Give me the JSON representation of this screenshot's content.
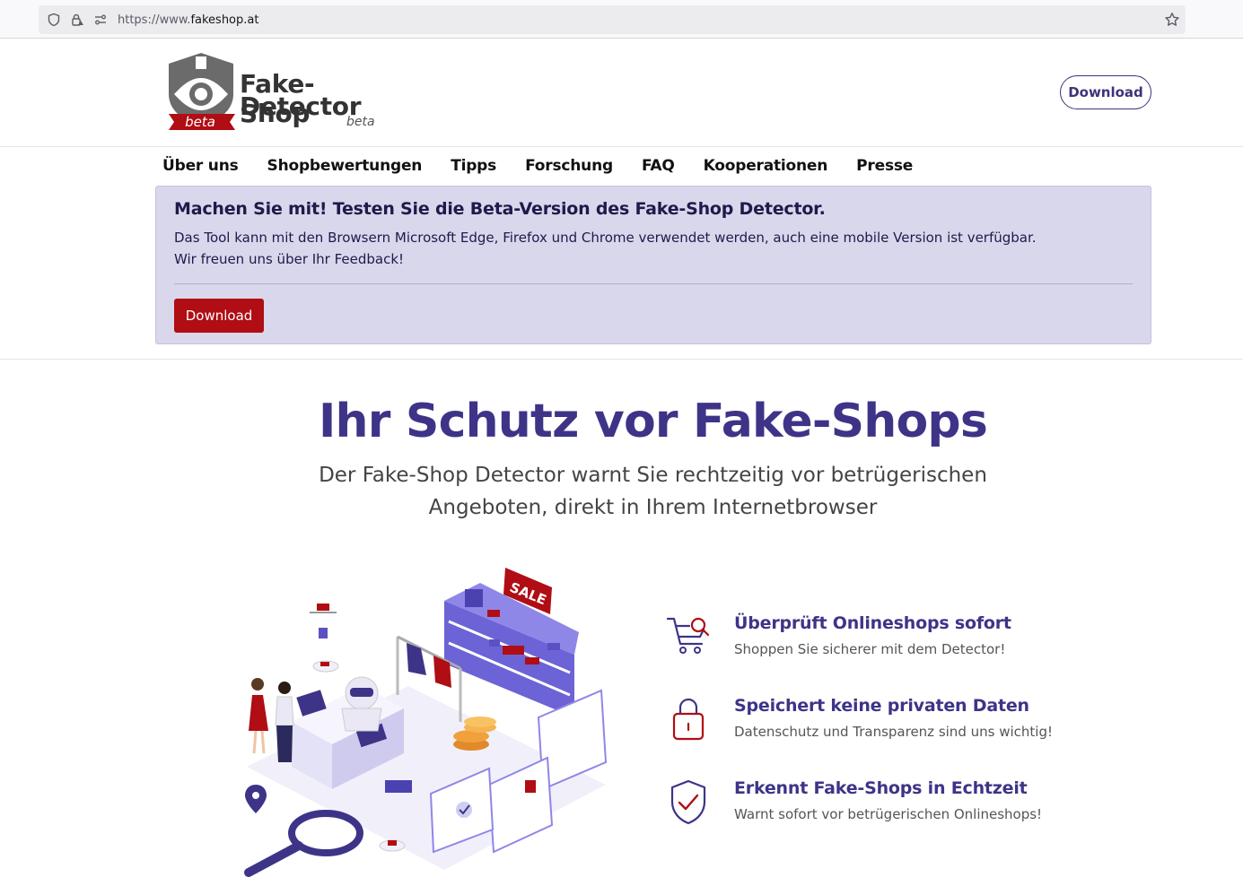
{
  "browser": {
    "url_prefix": "https://www.",
    "url_host": "fakeshop.at"
  },
  "header": {
    "logo_line1": "Fake-Shop",
    "logo_line2": "Detector",
    "logo_beta": "beta",
    "logo_ribbon": "beta",
    "download_label": "Download"
  },
  "nav": {
    "items": [
      {
        "label": "Über uns"
      },
      {
        "label": "Shopbewertungen"
      },
      {
        "label": "Tipps"
      },
      {
        "label": "Forschung"
      },
      {
        "label": "FAQ"
      },
      {
        "label": "Kooperationen"
      },
      {
        "label": "Presse"
      }
    ]
  },
  "banner": {
    "title": "Machen Sie mit! Testen Sie die Beta-Version des Fake-Shop Detector.",
    "line1": "Das Tool kann mit den Browsern Microsoft Edge, Firefox und Chrome verwendet werden, auch eine mobile Version ist verfügbar.",
    "line2": "Wir freuen uns über Ihr Feedback!",
    "download_label": "Download"
  },
  "hero": {
    "title": "Ihr Schutz vor Fake-Shops",
    "subtitle_line1": "Der Fake-Shop Detector warnt Sie rechtzeitig vor betrügerischen",
    "subtitle_line2": "Angeboten, direkt in Ihrem Internetbrowser"
  },
  "illustration": {
    "sale_tag": "SALE"
  },
  "features": [
    {
      "icon": "cart-search-icon",
      "title": "Überprüft Onlineshops sofort",
      "desc": "Shoppen Sie sicherer mit dem Detector!"
    },
    {
      "icon": "padlock-icon",
      "title": "Speichert keine privaten Daten",
      "desc": "Datenschutz und Transparenz sind uns wichtig!"
    },
    {
      "icon": "shield-check-icon",
      "title": "Erkennt Fake-Shops in Echtzeit",
      "desc": "Warnt sofort vor betrügerischen Onlineshops!"
    }
  ],
  "colors": {
    "brand_purple": "#3d3488",
    "banner_bg": "#d9d7ec",
    "download_red": "#b00d14"
  }
}
